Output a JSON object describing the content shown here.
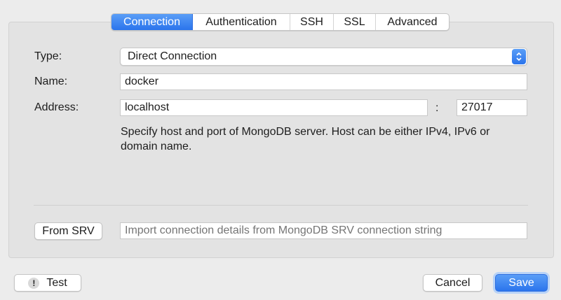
{
  "tabs": [
    {
      "label": "Connection",
      "active": true
    },
    {
      "label": "Authentication",
      "active": false
    },
    {
      "label": "SSH",
      "active": false
    },
    {
      "label": "SSL",
      "active": false
    },
    {
      "label": "Advanced",
      "active": false
    }
  ],
  "form": {
    "type_label": "Type:",
    "type_value": "Direct Connection",
    "name_label": "Name:",
    "name_value": "docker",
    "address_label": "Address:",
    "host_value": "localhost",
    "separator": ":",
    "port_value": "27017",
    "help_text": "Specify host and port of MongoDB server. Host can be either IPv4, IPv6 or domain name."
  },
  "srv": {
    "button_label": "From SRV",
    "placeholder": "Import connection details from MongoDB SRV connection string"
  },
  "footer": {
    "test_label": "Test",
    "test_icon": "!",
    "cancel_label": "Cancel",
    "save_label": "Save"
  },
  "colors": {
    "accent": "#2b74ec",
    "panel": "#e3e3e3",
    "window": "#ececec"
  }
}
